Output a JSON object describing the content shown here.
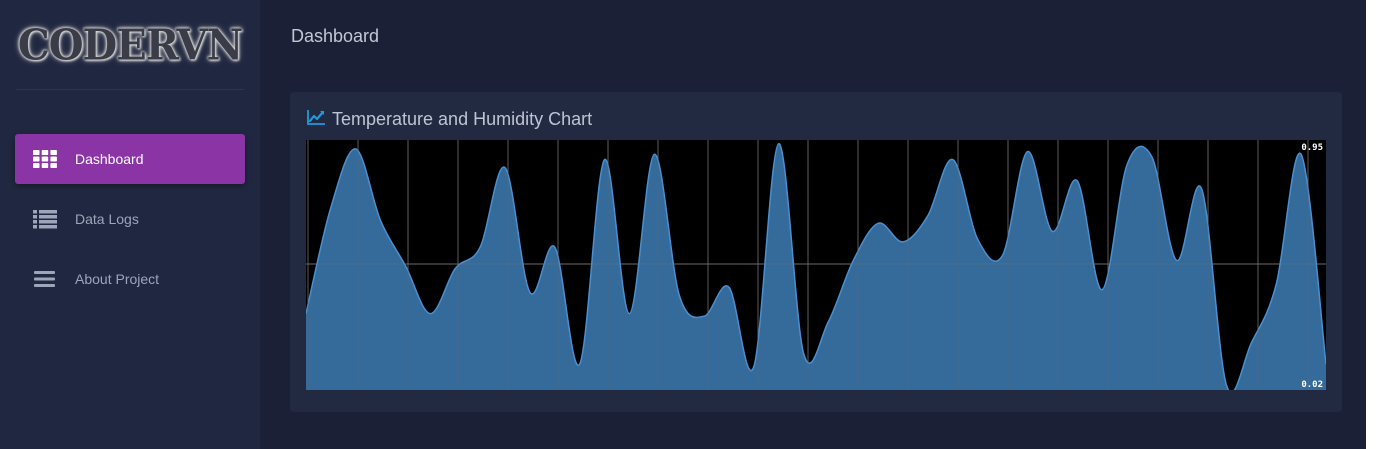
{
  "sidebar": {
    "logo_text": "CODERVN",
    "items": [
      {
        "label": "Dashboard",
        "icon": "grid-icon",
        "active": true
      },
      {
        "label": "Data Logs",
        "icon": "list-icon",
        "active": false
      },
      {
        "label": "About Project",
        "icon": "menu-icon",
        "active": false
      }
    ]
  },
  "header": {
    "title": "Dashboard"
  },
  "card": {
    "title": "Temperature and Humidity Chart",
    "icon": "line-chart-icon"
  },
  "colors": {
    "accent": "#8b34a6",
    "chart_fill": "#3a74a8",
    "chart_line": "#4a8fd0",
    "icon_blue": "#1e9ae0"
  },
  "chart_data": {
    "type": "area",
    "ymax_label": "0.95",
    "ymin_label": "0.02",
    "ylim": [
      0.02,
      0.95
    ],
    "values": [
      0.3,
      0.7,
      0.92,
      0.65,
      0.48,
      0.3,
      0.47,
      0.55,
      0.85,
      0.38,
      0.55,
      0.11,
      0.88,
      0.3,
      0.9,
      0.37,
      0.29,
      0.4,
      0.1,
      0.94,
      0.15,
      0.27,
      0.5,
      0.64,
      0.57,
      0.67,
      0.88,
      0.58,
      0.52,
      0.91,
      0.61,
      0.8,
      0.39,
      0.86,
      0.89,
      0.5,
      0.77,
      0.03,
      0.19,
      0.41,
      0.9,
      0.11
    ]
  }
}
